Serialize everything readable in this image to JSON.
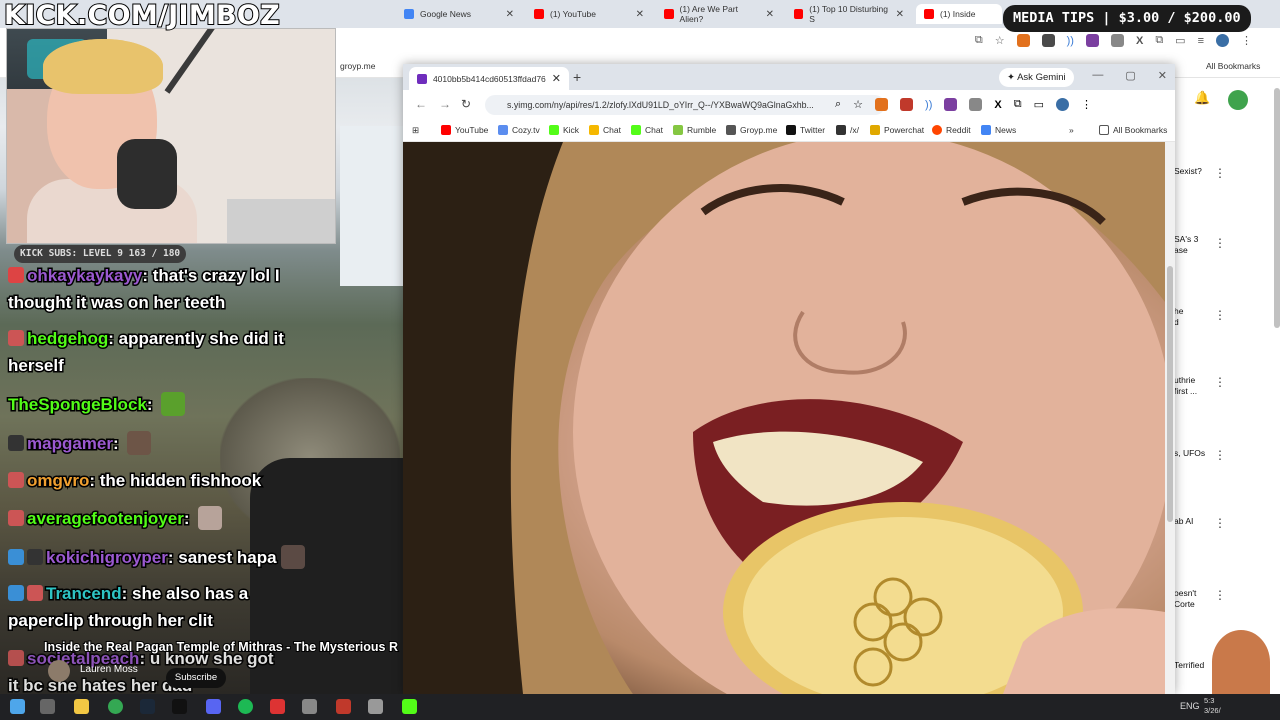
{
  "overlay": {
    "kick_title": "KICK.COM/JIMBOZ",
    "media_tips": "MEDIA TIPS | $3.00 / $200.00",
    "kick_subs": "KICK SUBS: LEVEL 9 163 / 180"
  },
  "outer_tabs": [
    {
      "label": "Google News",
      "color": "#4285f4"
    },
    {
      "label": "(1) YouTube",
      "color": "#ff0000"
    },
    {
      "label": "(1) Are We Part Alien?",
      "color": "#ff0000"
    },
    {
      "label": "(1) Top 10 Disturbing S",
      "color": "#ff0000"
    },
    {
      "label": "(1) Inside",
      "color": "#ff0000"
    }
  ],
  "outer_bookmarks": {
    "groyp": "groyp.me",
    "all_bookmarks": "All Bookmarks"
  },
  "popup": {
    "tab_title": "4010bb5b414cd60513ffdad76",
    "ask_gemini": "Ask Gemini",
    "url": "s.yimg.com/ny/api/res/1.2/zlofy.lXdU91LD_oYIrr_Q--/YXBwaWQ9aGlnaGxhb...",
    "bookmarks": [
      {
        "label": "YouTube",
        "color": "#ff0000"
      },
      {
        "label": "Cozy.tv",
        "color": "#5b8def"
      },
      {
        "label": "Kick",
        "color": "#53fc18"
      },
      {
        "label": "Chat",
        "color": "#f5b800"
      },
      {
        "label": "Chat",
        "color": "#53fc18"
      },
      {
        "label": "Rumble",
        "color": "#85c742"
      },
      {
        "label": "Groyp.me",
        "color": "#555555"
      },
      {
        "label": "Twitter",
        "color": "#111111"
      },
      {
        "label": "/x/",
        "color": "#333333"
      },
      {
        "label": "Powerchat",
        "color": "#e0a800"
      },
      {
        "label": "Reddit",
        "color": "#ff4500"
      },
      {
        "label": "News",
        "color": "#4285f4"
      }
    ],
    "all_bookmarks": "All Bookmarks"
  },
  "chat": [
    {
      "user": "ohkaykaykayy",
      "user_color": "#9b59d0",
      "text": "that's crazy lol I",
      "cont": "thought it was on her teeth",
      "badge_color": "#d44"
    },
    {
      "user": "hedgehog",
      "user_color": "#53fc18",
      "text": "apparently she did it",
      "cont": "herself",
      "badge_color": "#c55"
    },
    {
      "user": "TheSpongeBlock",
      "user_color": "#53fc18",
      "text": "",
      "cont": "",
      "badge_color": ""
    },
    {
      "user": "mapgamer",
      "user_color": "#9b59d0",
      "text": "",
      "cont": "",
      "badge_color": "#333"
    },
    {
      "user": "omgvro",
      "user_color": "#f0a030",
      "text": "the hidden fishhook",
      "cont": "",
      "badge_color": "#c55"
    },
    {
      "user": "averagefootenjoyer",
      "user_color": "#53fc18",
      "text": "",
      "cont": "",
      "badge_color": "#c55"
    },
    {
      "user": "kokichigroyper",
      "user_color": "#9b59d0",
      "text": "sanest hapa",
      "cont": "",
      "badge_color": "#3a8fd6"
    },
    {
      "user": "Trancend",
      "user_color": "#2ec4c4",
      "text": "she also has a",
      "cont": "paperclip through her clit",
      "badge_color": "#3a8fd6"
    },
    {
      "user": "societalpeach",
      "user_color": "#9b59d0",
      "text": "u know she got",
      "cont": "it bc she hates her dad",
      "badge_color": "#c55"
    }
  ],
  "yt_player": {
    "title": "Inside the Real Pagan Temple of Mithras - The Mysterious R",
    "channel": "Lauren Moss",
    "subscribe": "Subscribe"
  },
  "yt_sidebar": [
    {
      "text": "Sexist?"
    },
    {
      "text": "SA's 3\nase"
    },
    {
      "text": "he\nd"
    },
    {
      "text": "uthrie\nfirst ..."
    },
    {
      "text": "s, UFOs"
    },
    {
      "text": "ab AI"
    },
    {
      "text": "oesn't\nCorte"
    },
    {
      "text": "Terrified"
    }
  ],
  "taskbar": {
    "lang": "ENG",
    "time": "5:3",
    "date": "3/26/"
  },
  "colors": {
    "kick_green": "#53fc18",
    "accent_purple": "#6f2dbd"
  }
}
